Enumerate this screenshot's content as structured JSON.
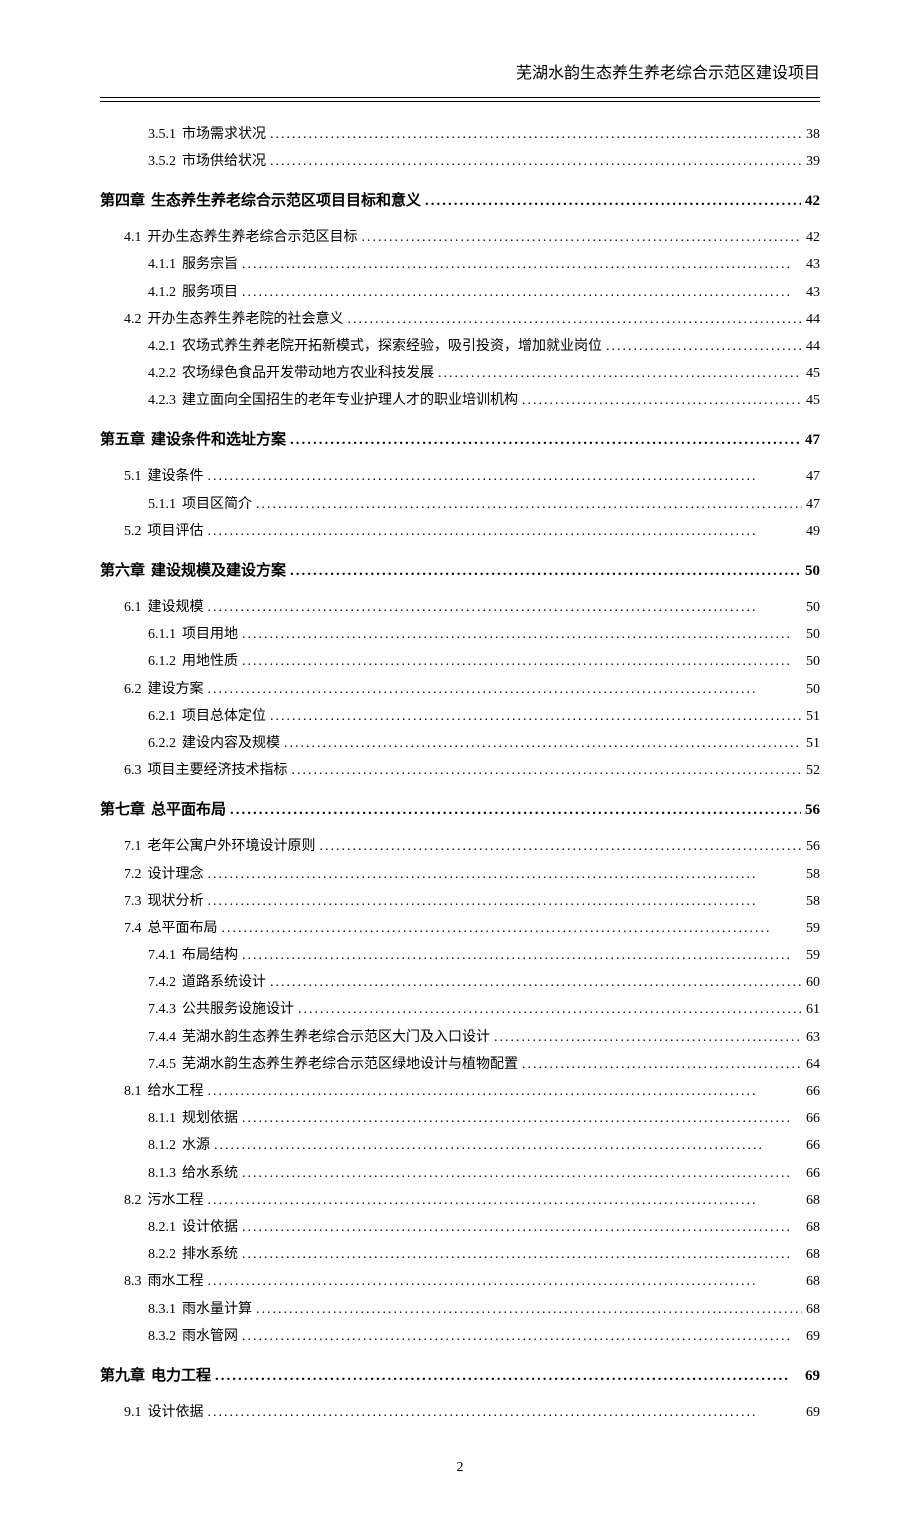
{
  "header_title": "芜湖水韵生态养生养老综合示范区建设项目",
  "page_number": "2",
  "toc": [
    {
      "level": 2,
      "num": "3.5.1",
      "text": "市场需求状况",
      "page": "38"
    },
    {
      "level": 2,
      "num": "3.5.2",
      "text": "市场供给状况",
      "page": "39"
    },
    {
      "level": 0,
      "num": "第四章",
      "text": "生态养生养老综合示范区项目目标和意义",
      "page": "42"
    },
    {
      "level": 1,
      "num": "4.1",
      "text": "开办生态养生养老综合示范区目标",
      "page": "42"
    },
    {
      "level": 2,
      "num": "4.1.1",
      "text": "服务宗旨",
      "page": "43"
    },
    {
      "level": 2,
      "num": "4.1.2",
      "text": "服务项目",
      "page": "43"
    },
    {
      "level": 1,
      "num": "4.2",
      "text": "开办生态养生养老院的社会意义",
      "page": "44"
    },
    {
      "level": 2,
      "num": "4.2.1",
      "text": "农场式养生养老院开拓新模式，探索经验，吸引投资，增加就业岗位",
      "page": "44"
    },
    {
      "level": 2,
      "num": "4.2.2",
      "text": "农场绿色食品开发带动地方农业科技发展",
      "page": "45"
    },
    {
      "level": 2,
      "num": "4.2.3",
      "text": "建立面向全国招生的老年专业护理人才的职业培训机构",
      "page": "45"
    },
    {
      "level": 0,
      "num": "第五章",
      "text": "建设条件和选址方案",
      "page": "47"
    },
    {
      "level": 1,
      "num": "5.1",
      "text": "建设条件",
      "page": "47"
    },
    {
      "level": 2,
      "num": "5.1.1",
      "text": "项目区简介",
      "page": "47"
    },
    {
      "level": 1,
      "num": "5.2",
      "text": "项目评估",
      "page": "49"
    },
    {
      "level": 0,
      "num": "第六章",
      "text": "建设规模及建设方案",
      "page": "50"
    },
    {
      "level": 1,
      "num": "6.1",
      "text": "建设规模",
      "page": "50"
    },
    {
      "level": 2,
      "num": "6.1.1",
      "text": "项目用地",
      "page": "50"
    },
    {
      "level": 2,
      "num": "6.1.2",
      "text": "用地性质",
      "page": "50"
    },
    {
      "level": 1,
      "num": "6.2",
      "text": "建设方案",
      "page": "50"
    },
    {
      "level": 2,
      "num": "6.2.1",
      "text": "项目总体定位",
      "page": "51"
    },
    {
      "level": 2,
      "num": "6.2.2",
      "text": "建设内容及规模",
      "page": "51"
    },
    {
      "level": 1,
      "num": "6.3",
      "text": "项目主要经济技术指标",
      "page": "52"
    },
    {
      "level": 0,
      "num": "第七章",
      "text": "总平面布局",
      "page": "56"
    },
    {
      "level": 1,
      "num": "7.1",
      "text": "老年公寓户外环境设计原则",
      "page": "56"
    },
    {
      "level": 1,
      "num": "7.2",
      "text": "设计理念",
      "page": "58"
    },
    {
      "level": 1,
      "num": "7.3",
      "text": "现状分析",
      "page": "58"
    },
    {
      "level": 1,
      "num": "7.4",
      "text": "总平面布局",
      "page": "59"
    },
    {
      "level": 2,
      "num": "7.4.1",
      "text": "布局结构",
      "page": "59"
    },
    {
      "level": 2,
      "num": "7.4.2",
      "text": "道路系统设计",
      "page": "60"
    },
    {
      "level": 2,
      "num": "7.4.3",
      "text": "公共服务设施设计",
      "page": "61"
    },
    {
      "level": 2,
      "num": "7.4.4",
      "text": "芜湖水韵生态养生养老综合示范区大门及入口设计",
      "page": "63"
    },
    {
      "level": 2,
      "num": "7.4.5",
      "text": "芜湖水韵生态养生养老综合示范区绿地设计与植物配置",
      "page": "64"
    },
    {
      "level": 1,
      "num": "8.1",
      "text": "给水工程",
      "page": "66"
    },
    {
      "level": 2,
      "num": "8.1.1",
      "text": "规划依据",
      "page": "66"
    },
    {
      "level": 2,
      "num": "8.1.2",
      "text": "水源",
      "page": "66"
    },
    {
      "level": 2,
      "num": "8.1.3",
      "text": "给水系统",
      "page": "66"
    },
    {
      "level": 1,
      "num": "8.2",
      "text": "污水工程",
      "page": "68"
    },
    {
      "level": 2,
      "num": "8.2.1",
      "text": "设计依据",
      "page": "68"
    },
    {
      "level": 2,
      "num": "8.2.2",
      "text": "排水系统",
      "page": "68"
    },
    {
      "level": 1,
      "num": "8.3",
      "text": "雨水工程",
      "page": "68"
    },
    {
      "level": 2,
      "num": "8.3.1",
      "text": "雨水量计算",
      "page": "68"
    },
    {
      "level": 2,
      "num": "8.3.2",
      "text": "雨水管网",
      "page": "69"
    },
    {
      "level": 0,
      "num": "第九章",
      "text": "电力工程",
      "page": "69"
    },
    {
      "level": 1,
      "num": "9.1",
      "text": "设计依据",
      "page": "69"
    }
  ]
}
